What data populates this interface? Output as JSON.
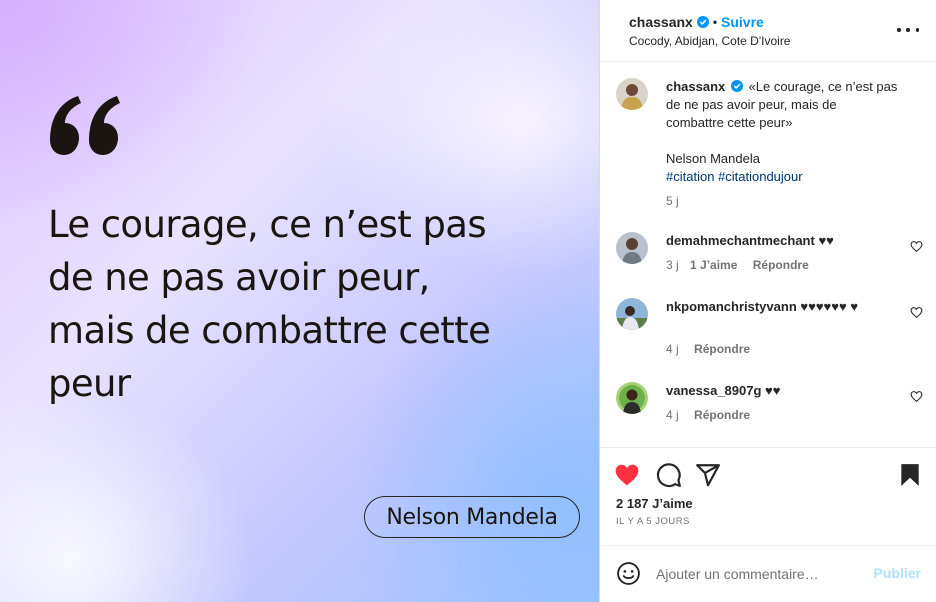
{
  "post_image": {
    "quote": "Le courage, ce n’est pas de ne pas avoir peur, mais de combattre cette peur",
    "quote_lines": [
      "Le courage, ce n’est pas",
      "de ne pas avoir peur,",
      "mais de combattre cette",
      "peur"
    ],
    "author": "Nelson Mandela",
    "quote_icon": "left-double-quote-icon"
  },
  "header": {
    "username": "chassanx",
    "verified_icon": "verified-badge-icon",
    "separator": "•",
    "follow_label": "Suivre",
    "location": "Cocody, Abidjan, Cote D'Ivoire",
    "more_icon": "more-options-icon"
  },
  "caption": {
    "username": "chassanx",
    "text_lines": [
      "«Le courage, ce n’est pas",
      "de ne pas avoir peur, mais de",
      "combattre cette peur»"
    ],
    "author": "Nelson Mandela",
    "hashtags": "#citation #citationdujour",
    "time": "5 j"
  },
  "comments": [
    {
      "username": "demahmechantmechant",
      "text": "♥♥",
      "time": "3 j",
      "likes": "1 J’aime",
      "reply": "Répondre"
    },
    {
      "username": "nkpomanchristyvann",
      "text": "♥♥♥♥♥♥ ♥",
      "time": "4 j",
      "likes": "",
      "reply": "Répondre"
    },
    {
      "username": "vanessa_8907g",
      "text": "♥♥",
      "time": "4 j",
      "likes": "",
      "reply": "Répondre"
    }
  ],
  "actions": {
    "like_icon": "heart-filled-icon",
    "comment_icon": "comment-icon",
    "share_icon": "share-icon",
    "save_icon": "bookmark-filled-icon",
    "likes": "2 187 J’aime",
    "time_ago": "IL Y A 5 JOURS"
  },
  "comment_bar": {
    "emoji_icon": "emoji-icon",
    "placeholder": "Ajouter un commentaire…",
    "publish_label": "Publier"
  },
  "colors": {
    "accent": "#0095f6",
    "like_red": "#ff3040",
    "publish_disabled": "#b2dffc",
    "hashtag": "#00376b"
  }
}
